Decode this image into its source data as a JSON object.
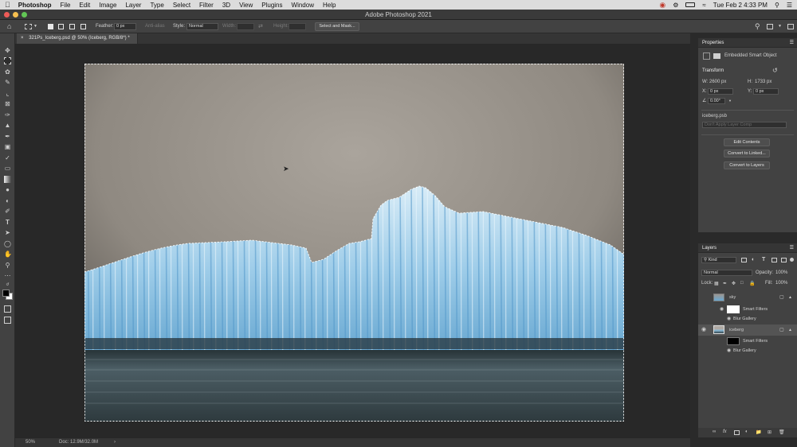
{
  "menubar": {
    "apple": "",
    "items": [
      "Photoshop",
      "File",
      "Edit",
      "Image",
      "Layer",
      "Type",
      "Select",
      "Filter",
      "3D",
      "View",
      "Plugins",
      "Window",
      "Help"
    ],
    "datetime": "Tue Feb 2  4:33 PM"
  },
  "window": {
    "title": "Adobe Photoshop 2021"
  },
  "options": {
    "feather_label": "Feather:",
    "feather_value": "0 px",
    "antialias_label": "Anti-alias",
    "style_label": "Style:",
    "style_value": "Normal",
    "width_label": "Width:",
    "height_label": "Height:",
    "select_mask_label": "Select and Mask..."
  },
  "document": {
    "tab_label": "321Ps_Iceberg.psd @ 50% (Iceberg, RGB/8*) *",
    "zoom": "50%",
    "doc_size": "Doc: 12.9M/32.0M"
  },
  "properties": {
    "title": "Properties",
    "object_type": "Embedded Smart Object",
    "transform_label": "Transform",
    "w_label": "W:",
    "w_value": "2600 px",
    "h_label": "H:",
    "h_value": "1733 px",
    "x_label": "X:",
    "x_value": "0 px",
    "y_label": "Y:",
    "y_value": "0 px",
    "angle_value": "0.00°",
    "filename": "iceberg.psb",
    "layer_comp_placeholder": "Don't Apply Layer Comp",
    "edit_contents": "Edit Contents",
    "convert_linked": "Convert to Linked...",
    "convert_layers": "Convert to Layers"
  },
  "layers": {
    "title": "Layers",
    "filter_kind": "Kind",
    "blend_mode": "Normal",
    "opacity_label": "Opacity:",
    "opacity_value": "100%",
    "lock_label": "Lock:",
    "fill_label": "Fill:",
    "fill_value": "100%",
    "items": [
      {
        "name": "sky",
        "smart_filters": "Smart Filters",
        "filter": "Blur Gallery",
        "visible": false
      },
      {
        "name": "iceberg",
        "smart_filters": "Smart Filters",
        "filter": "Blur Gallery",
        "visible": true
      }
    ]
  },
  "colors": {
    "accent": "#2d7bd6",
    "panel_bg": "#424242",
    "canvas_bg": "#282828"
  }
}
